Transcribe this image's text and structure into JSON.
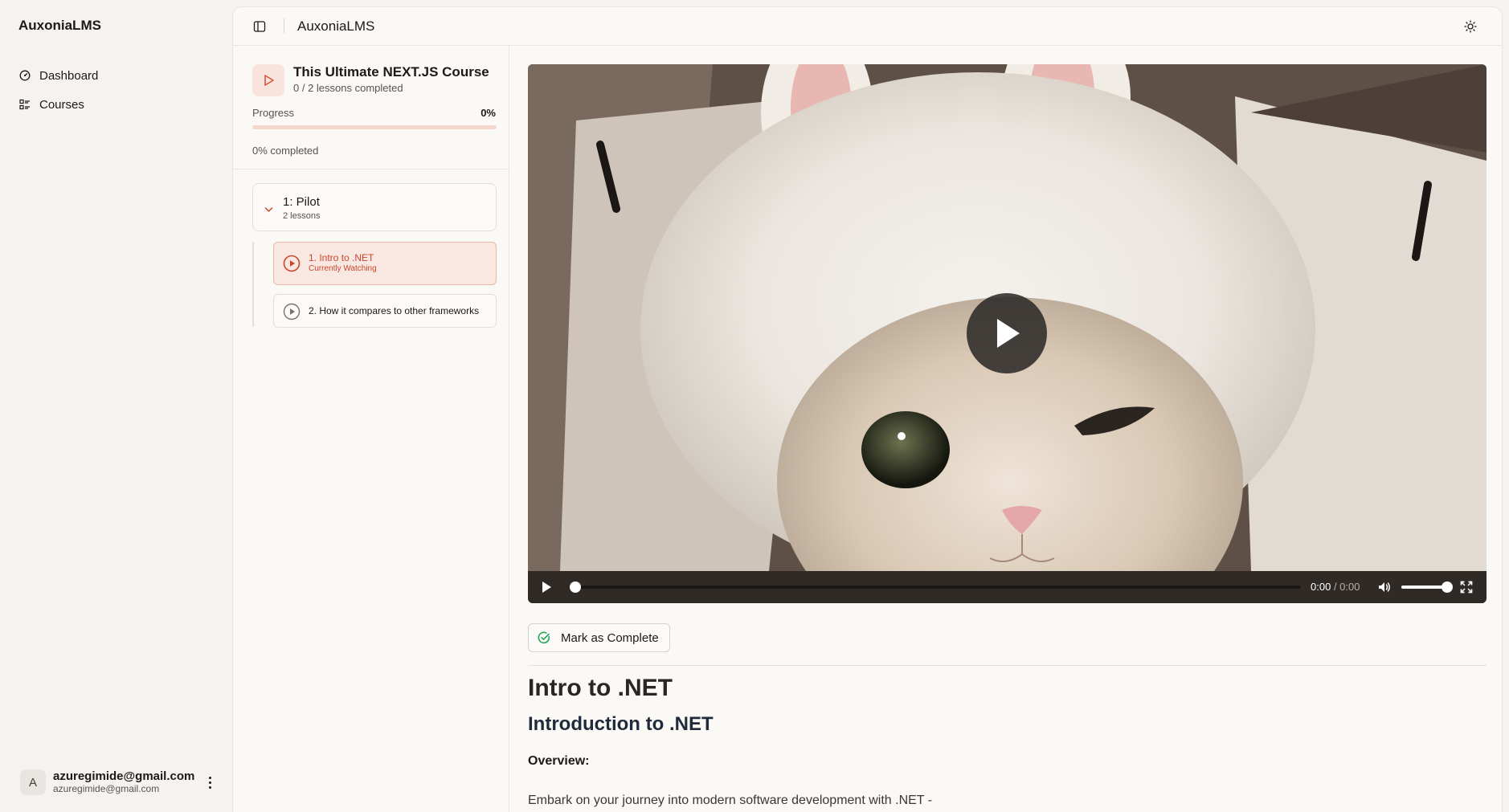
{
  "app": {
    "brand": "AuxoniaLMS"
  },
  "sidebar": {
    "items": [
      {
        "label": "Dashboard",
        "icon": "dashboard-icon"
      },
      {
        "label": "Courses",
        "icon": "list-icon"
      }
    ],
    "user": {
      "initial": "A",
      "name": "azuregimide@gmail.com",
      "email": "azuregimide@gmail.com"
    }
  },
  "topbar": {
    "title": "AuxoniaLMS"
  },
  "course": {
    "title": "This Ultimate NEXT.JS Course",
    "lessons_completed": "0 / 2 lessons completed",
    "progress_label": "Progress",
    "progress_percent_text": "0%",
    "progress_value": 0,
    "progress_completed_text": "0% completed",
    "modules": [
      {
        "title": "1: Pilot",
        "subtitle": "2 lessons",
        "lessons": [
          {
            "title": "1. Intro to .NET",
            "status": "Currently Watching",
            "active": true
          },
          {
            "title": "2. How it compares to other frameworks",
            "active": false
          }
        ]
      }
    ]
  },
  "player": {
    "current_time": "0:00",
    "duration": "/ 0:00",
    "seek_value": 0,
    "volume_value": 1
  },
  "actions": {
    "mark_complete": "Mark as Complete"
  },
  "lesson_content": {
    "lesson_title": "Intro to .NET",
    "heading": "Introduction to .NET",
    "section": "Overview:",
    "paragraph": "Embark on your journey into modern software development with .NET -"
  },
  "colors": {
    "accent": "#d7573a",
    "accent_light": "#f9e7e2",
    "success": "#22a55b",
    "background": "#f4f3ef"
  }
}
